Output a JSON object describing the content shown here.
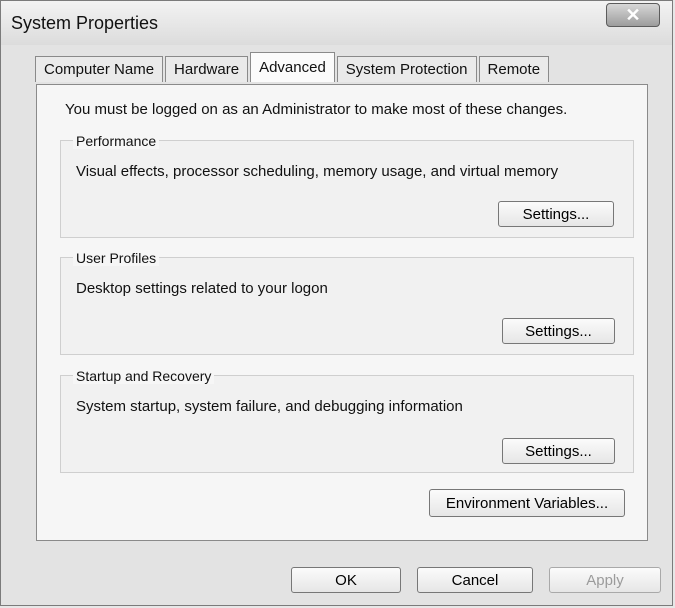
{
  "window": {
    "title": "System Properties"
  },
  "tabs": [
    {
      "label": "Computer Name"
    },
    {
      "label": "Hardware"
    },
    {
      "label": "Advanced"
    },
    {
      "label": "System Protection"
    },
    {
      "label": "Remote"
    }
  ],
  "advanced": {
    "note": "You must be logged on as an Administrator to make most of these changes.",
    "performance": {
      "title": "Performance",
      "description": "Visual effects, processor scheduling, memory usage, and virtual memory",
      "button": "Settings..."
    },
    "user_profiles": {
      "title": "User Profiles",
      "description": "Desktop settings related to your logon",
      "button": "Settings..."
    },
    "startup_recovery": {
      "title": "Startup and Recovery",
      "description": "System startup, system failure, and debugging information",
      "button": "Settings..."
    },
    "env_button": "Environment Variables..."
  },
  "footer": {
    "ok": "OK",
    "cancel": "Cancel",
    "apply": "Apply"
  }
}
